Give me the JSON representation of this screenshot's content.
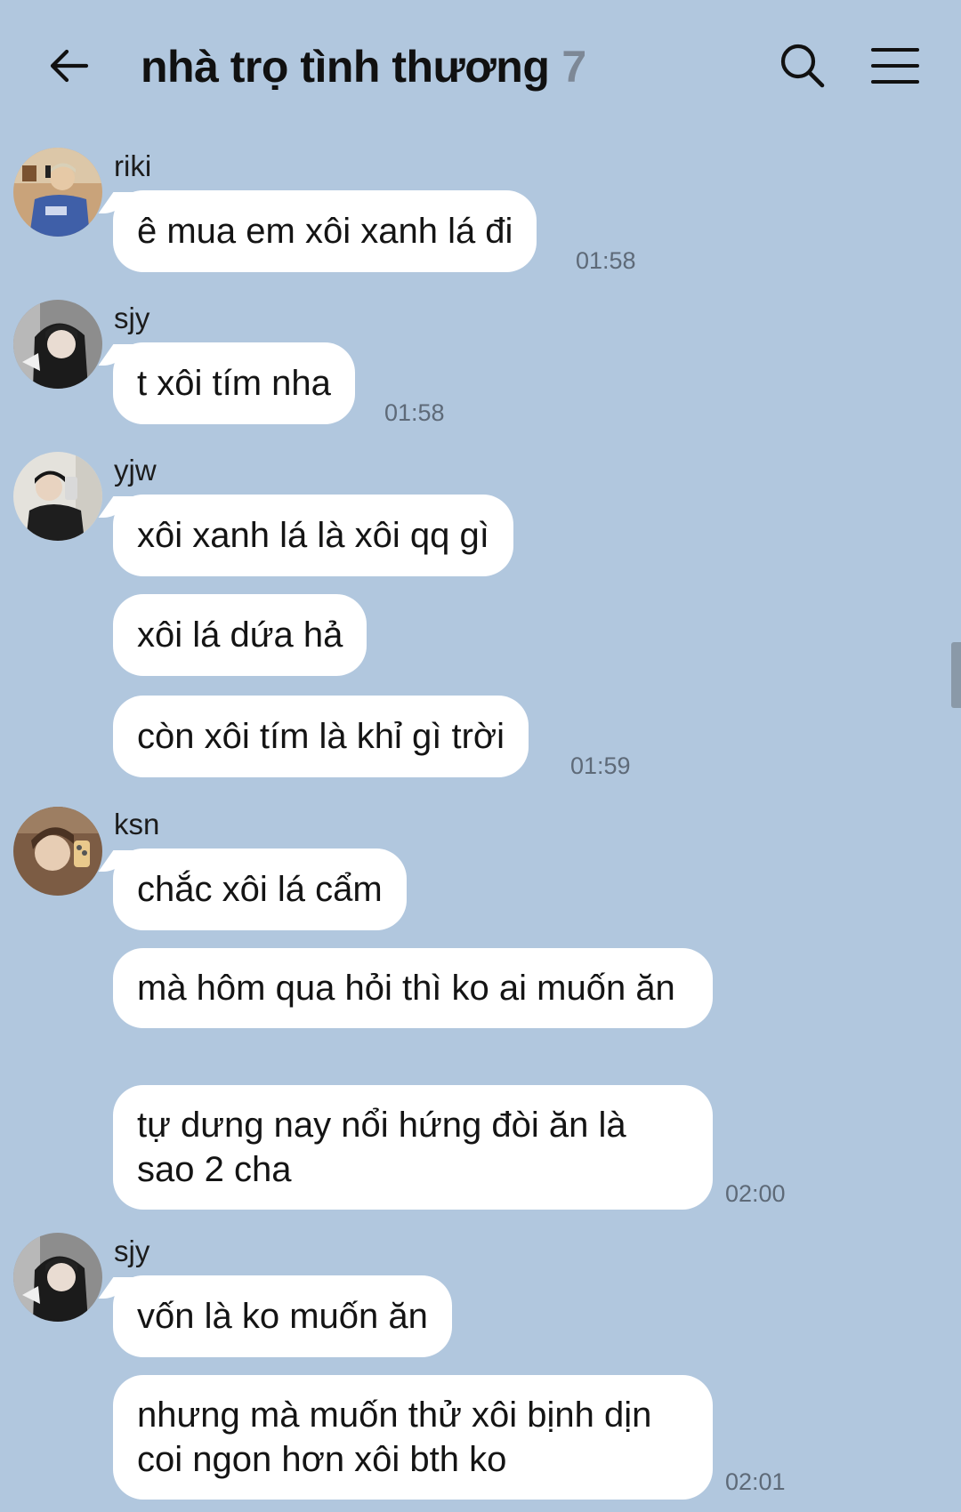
{
  "header": {
    "back_icon": "arrow-left-icon",
    "title": "nhà trọ tình thương",
    "member_count": "7",
    "search_icon": "search-icon",
    "menu_icon": "hamburger-menu-icon"
  },
  "colors": {
    "background": "#b1c7de",
    "bubble": "#ffffff",
    "timestamp": "#5e6a78",
    "member_count": "#7d8896"
  },
  "messages": [
    {
      "sender": "riki",
      "bubbles": [
        "ê mua em xôi xanh lá đi"
      ],
      "time": "01:58"
    },
    {
      "sender": "sjy",
      "bubbles": [
        "t xôi tím nha"
      ],
      "time": "01:58"
    },
    {
      "sender": "yjw",
      "bubbles": [
        "xôi xanh lá là xôi qq gì",
        "xôi lá dứa hả",
        "còn xôi tím là khỉ gì trời"
      ],
      "time": "01:59"
    },
    {
      "sender": "ksn",
      "bubbles": [
        "chắc xôi lá cẩm",
        "mà hôm qua hỏi thì ko ai muốn ăn",
        "tự dưng nay nổi hứng đòi ăn là sao 2 cha"
      ],
      "time": "02:00"
    },
    {
      "sender": "sjy",
      "bubbles": [
        "vốn là ko muốn ăn",
        "nhưng mà muốn thử xôi bịnh dịn coi ngon hơn xôi bth ko"
      ],
      "time": "02:01"
    }
  ]
}
